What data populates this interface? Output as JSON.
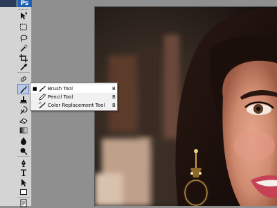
{
  "app": {
    "badge": "Ps"
  },
  "toolbar": {
    "tools": [
      {
        "name": "move-tool"
      },
      {
        "name": "marquee-tool"
      },
      {
        "name": "lasso-tool"
      },
      {
        "name": "quick-selection-tool"
      },
      {
        "name": "crop-tool"
      },
      {
        "name": "eyedropper-tool"
      },
      {
        "name": "healing-brush-tool"
      },
      {
        "name": "brush-tool",
        "selected": true
      },
      {
        "name": "clone-stamp-tool"
      },
      {
        "name": "history-brush-tool"
      },
      {
        "name": "eraser-tool"
      },
      {
        "name": "gradient-tool"
      },
      {
        "name": "blur-tool"
      },
      {
        "name": "dodge-tool"
      },
      {
        "name": "pen-tool"
      },
      {
        "name": "type-tool"
      },
      {
        "name": "path-selection-tool"
      },
      {
        "name": "shape-tool"
      },
      {
        "name": "notes-tool"
      }
    ]
  },
  "flyout": {
    "items": [
      {
        "label": "Brush Tool",
        "shortcut": "B",
        "active_mark": "■",
        "icon": "brush-icon"
      },
      {
        "label": "Pencil Tool",
        "shortcut": "B",
        "active_mark": "",
        "icon": "pencil-icon"
      },
      {
        "label": "Color Replacement Tool",
        "shortcut": "B",
        "active_mark": "",
        "icon": "color-replacement-icon"
      }
    ]
  },
  "colors": {
    "panel": "#d4d4d4",
    "workspace": "#8f8f8f",
    "menu_bg": "#f1f1f1",
    "selection": "#b8c9e6"
  }
}
